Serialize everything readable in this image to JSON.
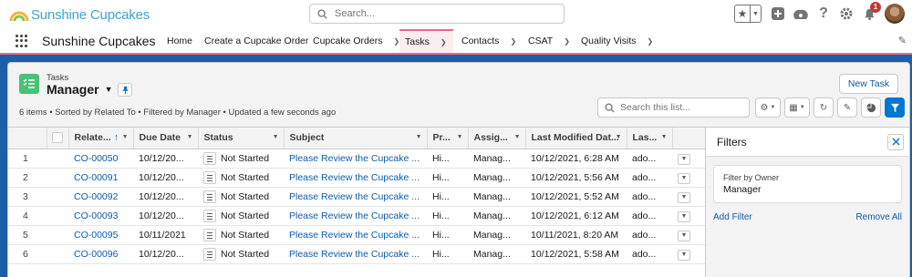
{
  "header": {
    "app_logo_text": "Sunshine Cupcakes",
    "search_placeholder": "Search...",
    "notification_count": "1"
  },
  "nav": {
    "app_name": "Sunshine Cupcakes",
    "items": [
      {
        "label": "Home",
        "has_menu": false
      },
      {
        "label": "Create a Cupcake Order",
        "has_menu": false
      },
      {
        "label": "Cupcake Orders",
        "has_menu": true
      },
      {
        "label": "Tasks",
        "has_menu": true,
        "active": true
      },
      {
        "label": "Contacts",
        "has_menu": true
      },
      {
        "label": "CSAT",
        "has_menu": true
      },
      {
        "label": "Quality Visits",
        "has_menu": true
      }
    ],
    "accent_color": "#e46c8a"
  },
  "list_view": {
    "object_label": "Tasks",
    "title": "Manager",
    "meta": "6 items • Sorted by Related To • Filtered by Manager • Updated a few seconds ago",
    "new_button": "New Task",
    "search_placeholder": "Search this list...",
    "columns": [
      "Relate...",
      "Due Date",
      "Status",
      "Subject",
      "Pr...",
      "Assig...",
      "Last Modified Dat...",
      "Las..."
    ],
    "sort_indicator": "↑",
    "rows": [
      {
        "n": "1",
        "related": "CO-00050",
        "due": "10/12/20...",
        "status": "Not Started",
        "subject": "Please Review the Cupcake ...",
        "priority": "Hi...",
        "assigned": "Manag...",
        "modified": "10/12/2021, 6:28 AM",
        "last": "ado..."
      },
      {
        "n": "2",
        "related": "CO-00091",
        "due": "10/12/20...",
        "status": "Not Started",
        "subject": "Please Review the Cupcake ...",
        "priority": "Hi...",
        "assigned": "Manag...",
        "modified": "10/12/2021, 5:56 AM",
        "last": "ado..."
      },
      {
        "n": "3",
        "related": "CO-00092",
        "due": "10/12/20...",
        "status": "Not Started",
        "subject": "Please Review the Cupcake ...",
        "priority": "Hi...",
        "assigned": "Manag...",
        "modified": "10/12/2021, 5:52 AM",
        "last": "ado..."
      },
      {
        "n": "4",
        "related": "CO-00093",
        "due": "10/12/20...",
        "status": "Not Started",
        "subject": "Please Review the Cupcake ...",
        "priority": "Hi...",
        "assigned": "Manag...",
        "modified": "10/12/2021, 6:12 AM",
        "last": "ado..."
      },
      {
        "n": "5",
        "related": "CO-00095",
        "due": "10/11/2021",
        "status": "Not Started",
        "subject": "Please Review the Cupcake ...",
        "priority": "Hi...",
        "assigned": "Manag...",
        "modified": "10/11/2021, 8:20 AM",
        "last": "ado..."
      },
      {
        "n": "6",
        "related": "CO-00096",
        "due": "10/12/20...",
        "status": "Not Started",
        "subject": "Please Review the Cupcake ...",
        "priority": "Hi...",
        "assigned": "Manag...",
        "modified": "10/12/2021, 5:58 AM",
        "last": "ado..."
      }
    ]
  },
  "filters": {
    "title": "Filters",
    "filter_label": "Filter by Owner",
    "filter_value": "Manager",
    "add_filter": "Add Filter",
    "remove_all": "Remove All"
  },
  "colors": {
    "brand_blue": "#0176d3",
    "link_blue": "#0b5cab",
    "task_icon_green": "#4bc076",
    "page_background": "#1b5fa8"
  }
}
